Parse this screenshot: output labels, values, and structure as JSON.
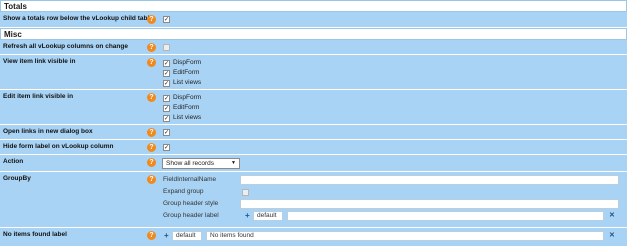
{
  "sections": {
    "totals": "Totals",
    "misc": "Misc"
  },
  "help_glyph": "?",
  "check_glyph": "✓",
  "totals_row": {
    "label": "Show a totals row below the vLookup child table",
    "checked": true
  },
  "refresh_row": {
    "label": "Refresh all vLookup columns on change",
    "checked": false
  },
  "view_link_row": {
    "label": "View item link visible in",
    "options": [
      {
        "label": "DispForm",
        "checked": true
      },
      {
        "label": "EditForm",
        "checked": true
      },
      {
        "label": "List views",
        "checked": true
      }
    ]
  },
  "edit_link_row": {
    "label": "Edit item link visible in",
    "options": [
      {
        "label": "DispForm",
        "checked": true
      },
      {
        "label": "EditForm",
        "checked": true
      },
      {
        "label": "List views",
        "checked": true
      }
    ]
  },
  "open_dialog_row": {
    "label": "Open links in new dialog box",
    "checked": true
  },
  "hide_label_row": {
    "label": "Hide form label on vLookup column",
    "checked": true
  },
  "action_row": {
    "label": "Action",
    "selected": "Show all records",
    "arrow": "▼"
  },
  "groupby_row": {
    "label": "GroupBy",
    "field_internal_name_label": "FieldInternalName",
    "field_internal_name_value": "",
    "expand_group_label": "Expand group",
    "expand_group_checked": false,
    "group_header_style_label": "Group header style",
    "group_header_style_value": "",
    "group_header_label_label": "Group header label",
    "plus": "+",
    "lang_tag": "default",
    "group_header_label_value": "",
    "remove": "✕"
  },
  "no_items_row": {
    "label": "No items found label",
    "plus": "+",
    "lang_tag": "default",
    "value": "No items found",
    "remove": "✕"
  },
  "colors": {
    "row_bg": "#a9d3f4",
    "help_icon": "#f08a1c",
    "remove_icon": "#1e4f86"
  }
}
